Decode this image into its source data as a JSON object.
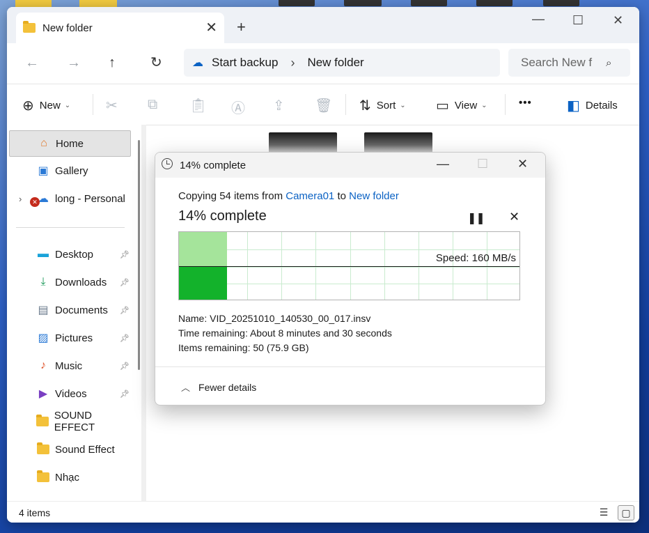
{
  "window": {
    "tab_title": "New folder",
    "tab_close": "✕",
    "new_tab": "+",
    "minimize": "—",
    "maximize": "☐",
    "close": "✕"
  },
  "address": {
    "segments": [
      "Start backup",
      "New folder"
    ],
    "separator": "›",
    "search_placeholder": "Search New f"
  },
  "toolbar": {
    "new_label": "New",
    "sort_label": "Sort",
    "view_label": "View",
    "more_label": "•••",
    "details_label": "Details"
  },
  "sidebar": {
    "items": [
      {
        "label": "Home",
        "icon": "home-icon"
      },
      {
        "label": "Gallery",
        "icon": "gallery-icon"
      },
      {
        "label": "long - Personal",
        "icon": "onedrive-icon"
      },
      {
        "label": "Desktop",
        "icon": "desktop-icon"
      },
      {
        "label": "Downloads",
        "icon": "downloads-icon"
      },
      {
        "label": "Documents",
        "icon": "documents-icon"
      },
      {
        "label": "Pictures",
        "icon": "pictures-icon"
      },
      {
        "label": "Music",
        "icon": "music-icon"
      },
      {
        "label": "Videos",
        "icon": "videos-icon"
      },
      {
        "label": "SOUND EFFECT",
        "icon": "folder-icon"
      },
      {
        "label": "Sound Effect",
        "icon": "folder-icon"
      },
      {
        "label": "Nhạc",
        "icon": "folder-icon"
      }
    ]
  },
  "status": {
    "item_count": "4 items"
  },
  "dialog": {
    "title": "14% complete",
    "copy_prefix": "Copying 54 items from ",
    "source": "Camera01",
    "copy_to": " to ",
    "destination": "New folder",
    "progress_text": "14% complete",
    "progress_fraction": 0.14,
    "speed": "Speed: 160 MB/s",
    "name_line": "Name:  VID_20251010_140530_00_017.insv",
    "time_line": "Time remaining:  About 8 minutes and 30 seconds",
    "items_line": "Items remaining:  50 (75.9 GB)",
    "fewer_details": "Fewer details",
    "colors": {
      "graph_fill": "#a5e49b",
      "graph_fill_dark": "#13b22b",
      "grid": "#c9ebcf",
      "link": "#0b62c4"
    }
  }
}
